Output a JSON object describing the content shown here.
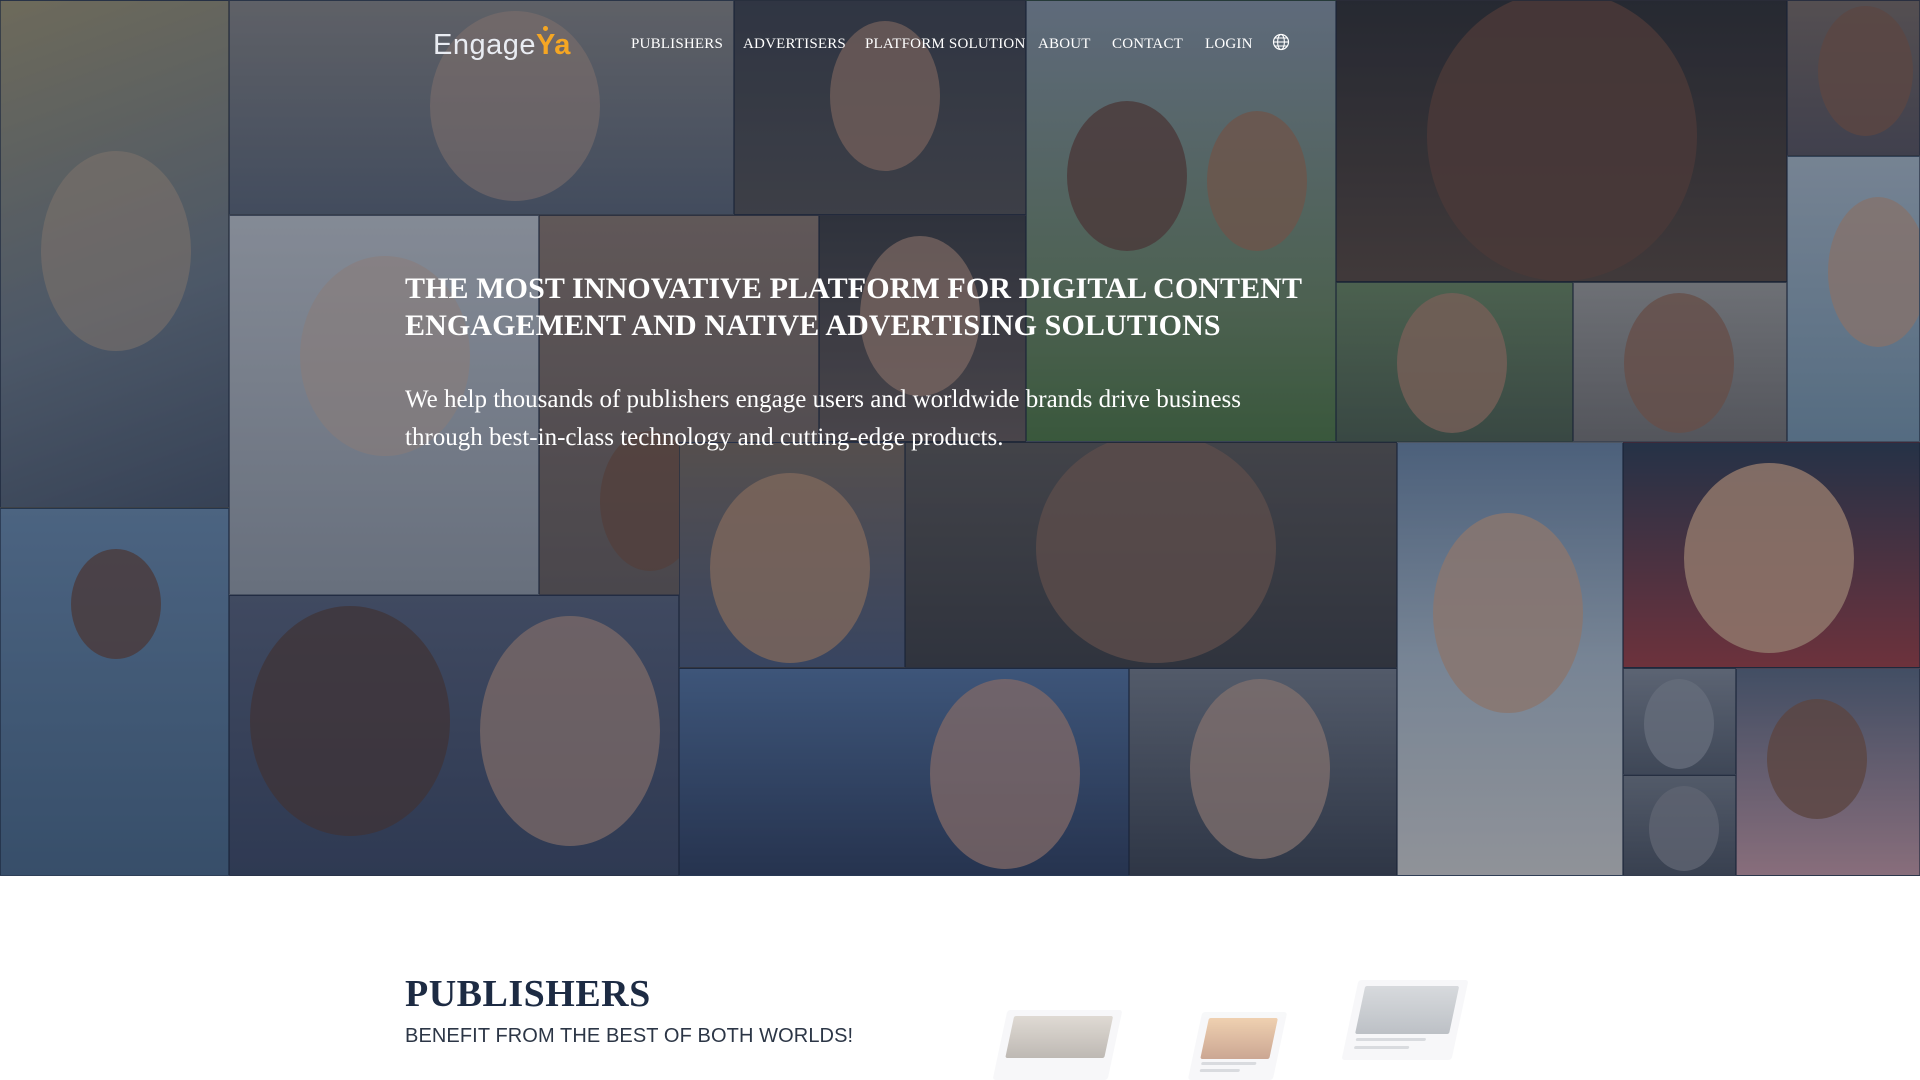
{
  "brand": {
    "logo_part1": "Engage",
    "logo_part2": "Ya",
    "accent_color": "#f5a623"
  },
  "nav": {
    "items": [
      "PUBLISHERS",
      "ADVERTISERS",
      "PLATFORM SOLUTION",
      "ABOUT",
      "CONTACT",
      "LOGIN"
    ],
    "language_icon": "globe-icon"
  },
  "hero": {
    "title_line1": "THE MOST INNOVATIVE PLATFORM FOR DIGITAL CONTENT",
    "title_line2": "ENGAGEMENT AND NATIVE ADVERTISING SOLUTIONS",
    "text_line1": "We help thousands of publishers engage users and worldwide brands drive business",
    "text_line2": "through best-in-class technology and cutting-edge products."
  },
  "publishers": {
    "title": "PUBLISHERS",
    "subtitle": "BENEFIT FROM THE BEST OF BOTH WORLDS!"
  },
  "colors": {
    "hero_overlay": "#1c2840",
    "heading_dark": "#1d2b43"
  }
}
